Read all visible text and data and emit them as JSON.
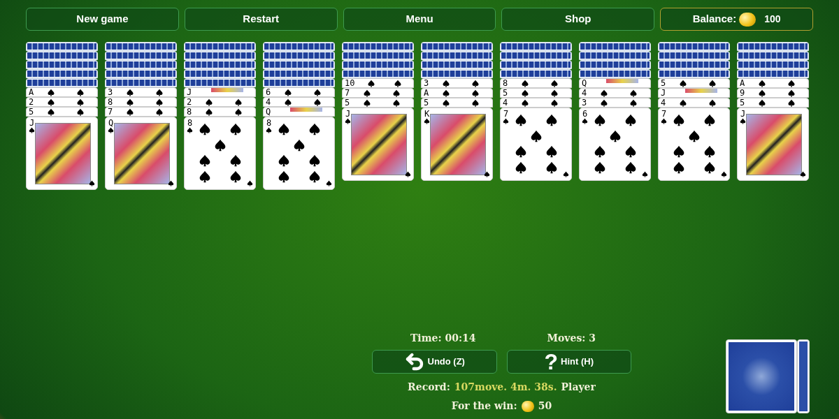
{
  "toolbar": {
    "buttons": [
      "New game",
      "Restart",
      "Menu",
      "Shop"
    ],
    "balance": {
      "label": "Balance:",
      "amount": "100"
    }
  },
  "columns": [
    {
      "cards": [
        {
          "kind": "back"
        },
        {
          "kind": "back"
        },
        {
          "kind": "back"
        },
        {
          "kind": "back"
        },
        {
          "kind": "back"
        },
        {
          "kind": "pip",
          "rank": "A"
        },
        {
          "kind": "pip",
          "rank": "2"
        },
        {
          "kind": "pip",
          "rank": "5"
        },
        {
          "kind": "court",
          "rank": "J"
        }
      ]
    },
    {
      "cards": [
        {
          "kind": "back"
        },
        {
          "kind": "back"
        },
        {
          "kind": "back"
        },
        {
          "kind": "back"
        },
        {
          "kind": "back"
        },
        {
          "kind": "pip",
          "rank": "3"
        },
        {
          "kind": "pip",
          "rank": "8"
        },
        {
          "kind": "pip",
          "rank": "7"
        },
        {
          "kind": "court",
          "rank": "Q"
        }
      ]
    },
    {
      "cards": [
        {
          "kind": "back"
        },
        {
          "kind": "back"
        },
        {
          "kind": "back"
        },
        {
          "kind": "back"
        },
        {
          "kind": "back"
        },
        {
          "kind": "court",
          "rank": "J"
        },
        {
          "kind": "pip",
          "rank": "2"
        },
        {
          "kind": "pip",
          "rank": "8"
        },
        {
          "kind": "pip",
          "rank": "8"
        }
      ]
    },
    {
      "cards": [
        {
          "kind": "back"
        },
        {
          "kind": "back"
        },
        {
          "kind": "back"
        },
        {
          "kind": "back"
        },
        {
          "kind": "back"
        },
        {
          "kind": "pip",
          "rank": "6"
        },
        {
          "kind": "pip",
          "rank": "4"
        },
        {
          "kind": "court",
          "rank": "Q"
        },
        {
          "kind": "pip",
          "rank": "8"
        }
      ]
    },
    {
      "cards": [
        {
          "kind": "back"
        },
        {
          "kind": "back"
        },
        {
          "kind": "back"
        },
        {
          "kind": "back"
        },
        {
          "kind": "pip",
          "rank": "10"
        },
        {
          "kind": "pip",
          "rank": "7"
        },
        {
          "kind": "pip",
          "rank": "5"
        },
        {
          "kind": "court",
          "rank": "J"
        }
      ]
    },
    {
      "cards": [
        {
          "kind": "back"
        },
        {
          "kind": "back"
        },
        {
          "kind": "back"
        },
        {
          "kind": "back"
        },
        {
          "kind": "pip",
          "rank": "3"
        },
        {
          "kind": "pip",
          "rank": "A"
        },
        {
          "kind": "pip",
          "rank": "5"
        },
        {
          "kind": "court",
          "rank": "K"
        }
      ]
    },
    {
      "cards": [
        {
          "kind": "back"
        },
        {
          "kind": "back"
        },
        {
          "kind": "back"
        },
        {
          "kind": "back"
        },
        {
          "kind": "pip",
          "rank": "8"
        },
        {
          "kind": "pip",
          "rank": "5"
        },
        {
          "kind": "pip",
          "rank": "4"
        },
        {
          "kind": "pip",
          "rank": "7"
        }
      ]
    },
    {
      "cards": [
        {
          "kind": "back"
        },
        {
          "kind": "back"
        },
        {
          "kind": "back"
        },
        {
          "kind": "back"
        },
        {
          "kind": "court",
          "rank": "Q"
        },
        {
          "kind": "pip",
          "rank": "4"
        },
        {
          "kind": "pip",
          "rank": "3"
        },
        {
          "kind": "pip",
          "rank": "6"
        }
      ]
    },
    {
      "cards": [
        {
          "kind": "back"
        },
        {
          "kind": "back"
        },
        {
          "kind": "back"
        },
        {
          "kind": "back"
        },
        {
          "kind": "pip",
          "rank": "5"
        },
        {
          "kind": "court",
          "rank": "J"
        },
        {
          "kind": "pip",
          "rank": "4"
        },
        {
          "kind": "pip",
          "rank": "7"
        }
      ]
    },
    {
      "cards": [
        {
          "kind": "back"
        },
        {
          "kind": "back"
        },
        {
          "kind": "back"
        },
        {
          "kind": "back"
        },
        {
          "kind": "pip",
          "rank": "A"
        },
        {
          "kind": "pip",
          "rank": "9"
        },
        {
          "kind": "pip",
          "rank": "5"
        },
        {
          "kind": "court",
          "rank": "J"
        }
      ]
    }
  ],
  "status": {
    "time": "Time: 00:14",
    "moves": "Moves: 3"
  },
  "actions": [
    {
      "kind": "undo",
      "label": "Undo (Z)"
    },
    {
      "kind": "hint",
      "icon": "?",
      "label": "Hint (H)"
    }
  ],
  "record": {
    "label": "Record:",
    "value": "107move. 4m. 38s.",
    "holder": "Player"
  },
  "reward": {
    "label": "For the win:",
    "amount": "50"
  }
}
